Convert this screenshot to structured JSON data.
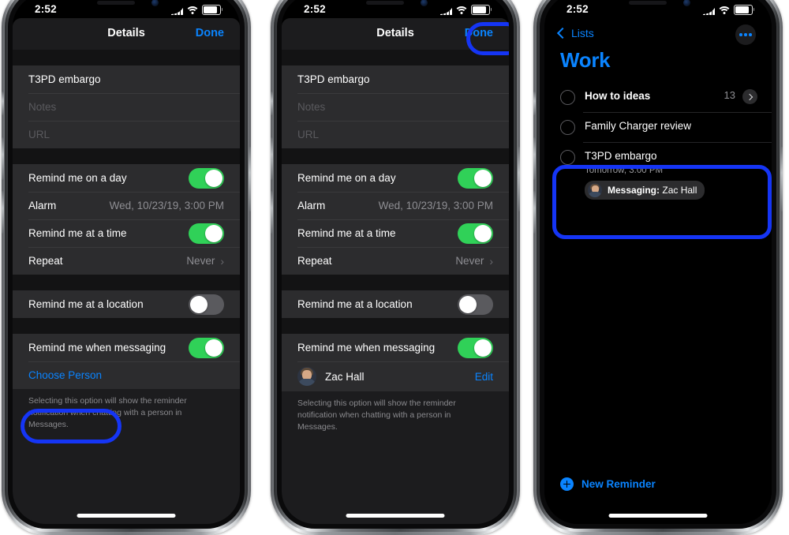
{
  "meta": {
    "device_count": 3,
    "accent_blue": "#0a84ff",
    "annotation_blue": "#1535f5",
    "toggle_on_green": "#30d158",
    "sheet_bg": "#1c1c1e",
    "group_bg": "#2c2c2e"
  },
  "status_bar": {
    "time": "2:52",
    "cellular_icon": "signal-bars-icon",
    "wifi_icon": "wifi-icon",
    "battery_icon": "battery-icon"
  },
  "phone1": {
    "nav": {
      "title": "Details",
      "done_label": "Done"
    },
    "fields": {
      "title_value": "T3PD embargo",
      "notes_placeholder": "Notes",
      "url_placeholder": "URL"
    },
    "rows": {
      "remind_day_label": "Remind me on a day",
      "remind_day_state": "on",
      "alarm_label": "Alarm",
      "alarm_value": "Wed, 10/23/19, 3:00 PM",
      "remind_time_label": "Remind me at a time",
      "remind_time_state": "on",
      "repeat_label": "Repeat",
      "repeat_value": "Never",
      "repeat_chevron": "chevron-right-icon",
      "remind_location_label": "Remind me at a location",
      "remind_location_state": "off",
      "remind_messaging_label": "Remind me when messaging",
      "remind_messaging_state": "on",
      "choose_person_label": "Choose Person"
    },
    "footnote": "Selecting this option will show the reminder notification when chatting with a person in Messages.",
    "highlight": "choose-person"
  },
  "phone2": {
    "nav": {
      "title": "Details",
      "done_label": "Done"
    },
    "fields": {
      "title_value": "T3PD embargo",
      "notes_placeholder": "Notes",
      "url_placeholder": "URL"
    },
    "rows": {
      "remind_day_label": "Remind me on a day",
      "remind_day_state": "on",
      "alarm_label": "Alarm",
      "alarm_value": "Wed, 10/23/19, 3:00 PM",
      "remind_time_label": "Remind me at a time",
      "remind_time_state": "on",
      "repeat_label": "Repeat",
      "repeat_value": "Never",
      "repeat_chevron": "chevron-right-icon",
      "remind_location_label": "Remind me at a location",
      "remind_location_state": "off",
      "remind_messaging_label": "Remind me when messaging",
      "remind_messaging_state": "on"
    },
    "person": {
      "name": "Zac Hall",
      "edit_label": "Edit",
      "avatar": "contact-photo-zac-hall"
    },
    "footnote": "Selecting this option will show the reminder notification when chatting with a person in Messages.",
    "highlight": "done-button"
  },
  "phone3": {
    "back_label": "Lists",
    "back_icon": "chevron-left-icon",
    "more_icon": "more-options-icon",
    "list_title": "Work",
    "reminders": [
      {
        "title": "How to ideas",
        "count": "13",
        "disclosure": "chevron-right-icon"
      },
      {
        "title": "Family Charger review"
      },
      {
        "title": "T3PD embargo",
        "due": "Tomorrow, 3:00 PM",
        "chip_prefix": "Messaging:",
        "chip_name": "Zac Hall",
        "chip_avatar": "contact-photo-zac-hall"
      }
    ],
    "new_reminder_label": "New Reminder",
    "new_reminder_icon": "plus-circle-icon",
    "highlight": "t3pd-embargo-reminder"
  }
}
